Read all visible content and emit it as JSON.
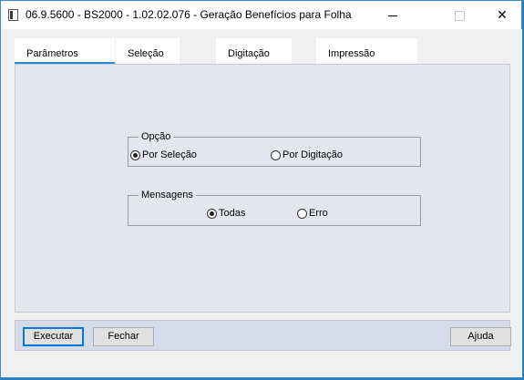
{
  "window": {
    "title": "06.9.5600 - BS2000 - 1.02.02.076 - Geração Benefícios para Folha"
  },
  "tabs": [
    {
      "label": "Parâmetros",
      "active": true
    },
    {
      "label": "Seleção",
      "active": false
    },
    {
      "label": "Digitação",
      "active": false
    },
    {
      "label": "Impressão",
      "active": false
    }
  ],
  "opcao": {
    "legend": "Opção",
    "options": [
      {
        "label": "Por Seleção",
        "checked": true
      },
      {
        "label": "Por Digitação",
        "checked": false
      }
    ]
  },
  "mensagens": {
    "legend": "Mensagens",
    "options": [
      {
        "label": "Todas",
        "checked": true
      },
      {
        "label": "Erro",
        "checked": false
      }
    ]
  },
  "buttons": {
    "execute": "Executar",
    "close": "Fechar",
    "help": "Ajuda"
  },
  "colors": {
    "accent": "#2a8bd6",
    "page_bg": "#e4e6ef",
    "footer_bg": "#d6dbea"
  }
}
